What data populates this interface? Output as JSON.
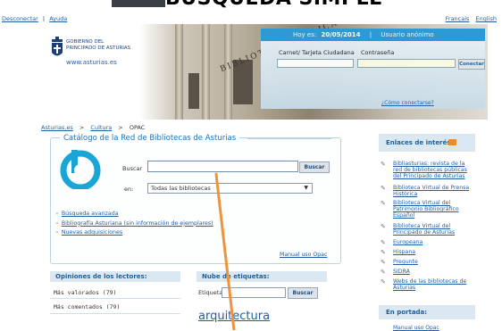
{
  "slide_title": "BÚSQUEDA SIMPLE",
  "top_links": {
    "disconnect": "Desconectar",
    "help": "Ayuda",
    "separator": "|"
  },
  "languages": [
    "Français",
    "English"
  ],
  "header": {
    "logo_line1": "GOBIERNO DEL",
    "logo_line2": "PRINCIPADO DE ASTURIAS",
    "logo_url": "www.asturias.es",
    "building_lettering": "BIBLIOTECA PÚBLICA",
    "date_prefix": "Hoy es:",
    "date": "20/05/2014",
    "date_separator": "|",
    "user": "Usuario anónimo",
    "card_label": "Carnet/ Tarjeta Ciudadana",
    "password_label": "Contraseña",
    "connect_button": "Conectar",
    "forgot_link": "¿Cómo conectarse?"
  },
  "breadcrumb": [
    "Asturias.es",
    "Cultura",
    "OPAC"
  ],
  "breadcrumb_separator": ">",
  "catalog": {
    "title": "Catálogo de la Red de Bibliotecas de Asturias",
    "search_label": "Buscar",
    "search_value": "",
    "search_button": "Buscar",
    "in_label": "en:",
    "in_selected": "Todas las bibliotecas",
    "links": [
      "Búsqueda avanzada",
      "Bibliografía Asturiana (sin información de ejemplares)",
      "Nuevas adquisiciones"
    ],
    "manual_link": "Manual uso Opac"
  },
  "opinions": {
    "title": "Opiniones de los lectores:",
    "rows": [
      "Más valorados (79)",
      "Más comentados (79)"
    ]
  },
  "tag_cloud": {
    "title": "Nube de etiquetas:",
    "tag_label": "Etiqueta",
    "button": "Buscar",
    "visible_tag": "arquitectura"
  },
  "interest_links": {
    "title": "Enlaces de interés:",
    "items": [
      "Bibliasturias: revista de la red de bibliotecas públicas del Principado de Asturias",
      "Biblioteca Virtual de Prensa Histórica",
      "Biblioteca Virtual del Patrimonio Bibliográfico Español",
      "Biblioteca Virtual del Principado de Asturias",
      "Europeana",
      "Hispana",
      "Pregunte",
      "SIDRA",
      "Webs de las bibliotecas de Asturias"
    ]
  },
  "portada": {
    "title": "En portada:",
    "first_item": "Manual uso Opac"
  },
  "colors": {
    "accent_blue": "#2e9ad4",
    "link_blue": "#1f5fa8",
    "panel_blue": "#dce8f1",
    "annotation_orange": "#f0923a"
  },
  "icons": {
    "logo": "asturias-crest-icon",
    "catalog": "library-logo-icon",
    "rss": "rss-icon",
    "link_bullet": "pen-icon"
  }
}
